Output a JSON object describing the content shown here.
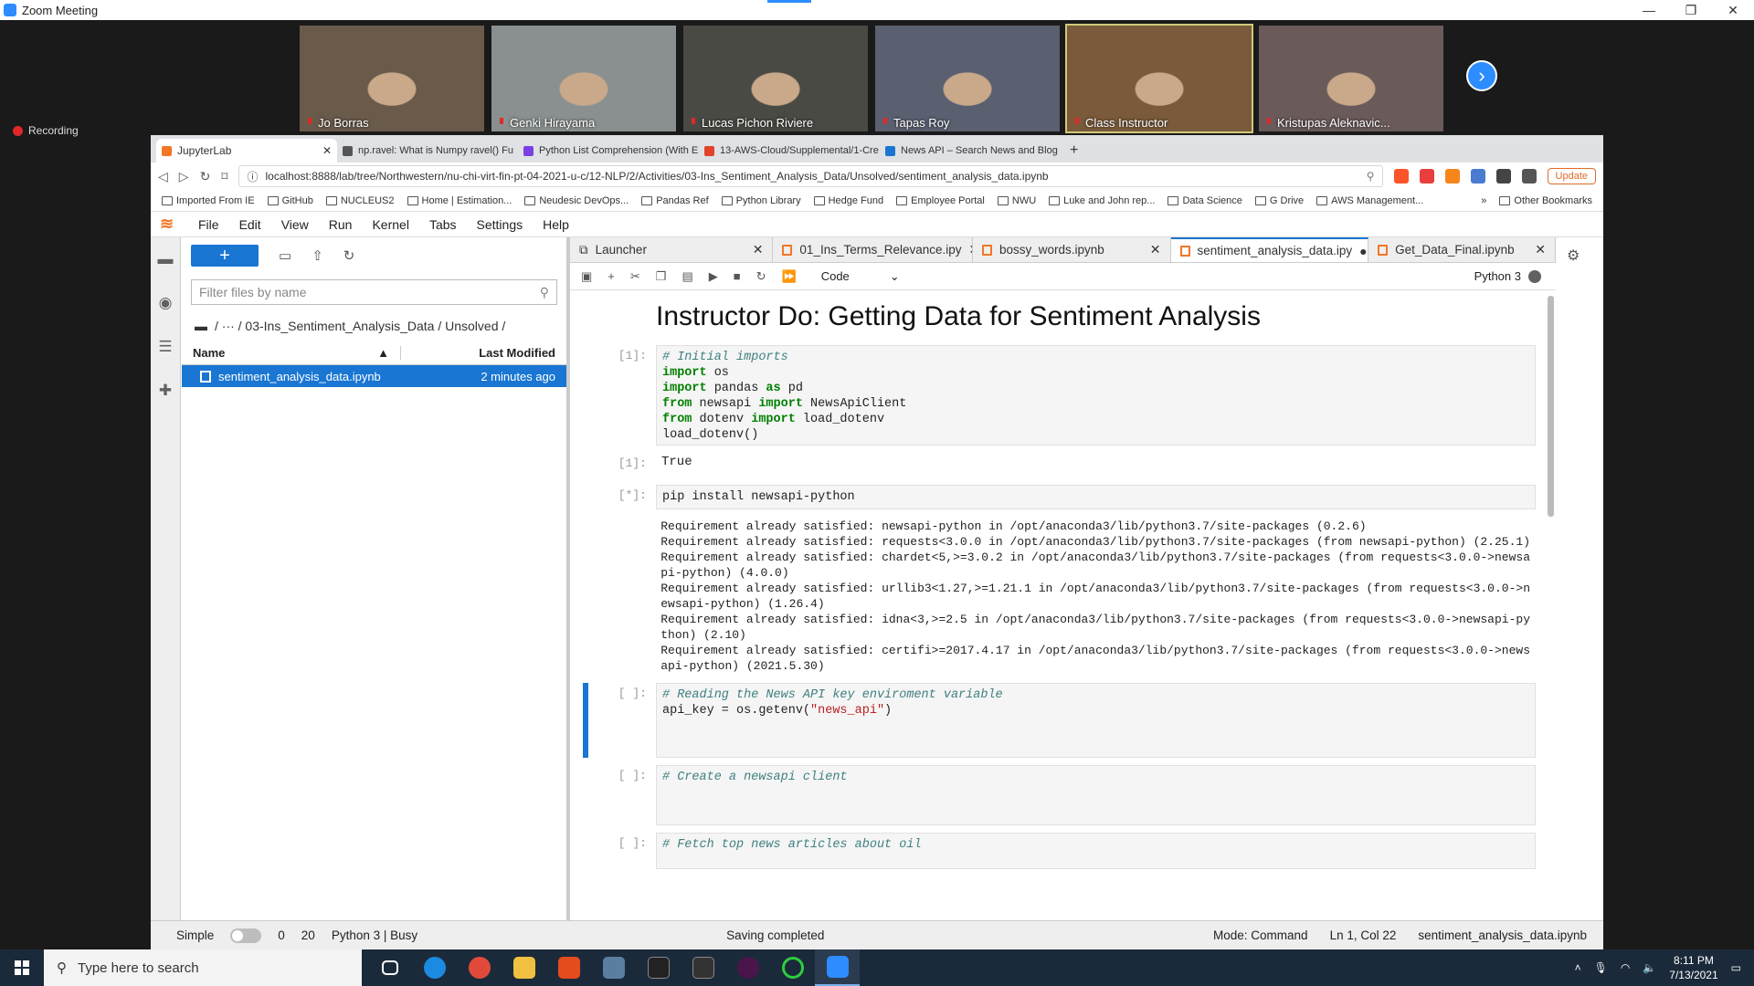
{
  "zoom": {
    "title": "Zoom Meeting",
    "recording": "Recording"
  },
  "participants": [
    {
      "name": "Jo Borras",
      "bg": "#6a5a4a"
    },
    {
      "name": "Genki Hirayama",
      "bg": "#8a9090"
    },
    {
      "name": "Lucas Pichon Riviere",
      "bg": "#4a4a44"
    },
    {
      "name": "Tapas Roy",
      "bg": "#5a6070"
    },
    {
      "name": "Class Instructor",
      "bg": "#7a5a3a"
    },
    {
      "name": "Kristupas Aleknavic...",
      "bg": "#6a5a5a"
    }
  ],
  "browser": {
    "tabs": [
      {
        "label": "JupyterLab",
        "color": "#f37726"
      },
      {
        "label": "np.ravel: What is Numpy ravel() Fu",
        "color": "#555"
      },
      {
        "label": "Python List Comprehension (With E",
        "color": "#7b3fe4"
      },
      {
        "label": "13-AWS-Cloud/Supplemental/1-Cre",
        "color": "#e24329"
      },
      {
        "label": "News API – Search News and Blog",
        "color": "#1976d2"
      }
    ],
    "url": "localhost:8888/lab/tree/Northwestern/nu-chi-virt-fin-pt-04-2021-u-c/12-NLP/2/Activities/03-Ins_Sentiment_Analysis_Data/Unsolved/sentiment_analysis_data.ipynb",
    "update": "Update",
    "bookmarks": [
      "Imported From IE",
      "GitHub",
      "NUCLEUS2",
      "Home | Estimation...",
      "Neudesic DevOps...",
      "Pandas Ref",
      "Python Library",
      "Hedge Fund",
      "Employee Portal",
      "NWU",
      "Luke and John rep...",
      "Data Science",
      "G Drive",
      "AWS Management..."
    ],
    "more": "»",
    "other_bookmarks": "Other Bookmarks"
  },
  "jupyter": {
    "menu": [
      "File",
      "Edit",
      "View",
      "Run",
      "Kernel",
      "Tabs",
      "Settings",
      "Help"
    ],
    "filter_placeholder": "Filter files by name",
    "crumbs": "/   ···  / 03-Ins_Sentiment_Analysis_Data / Unsolved /",
    "col_name": "Name",
    "col_modified": "Last Modified",
    "file": {
      "name": "sentiment_analysis_data.ipynb",
      "modified": "2 minutes ago"
    },
    "doc_tabs": [
      {
        "label": "Launcher",
        "width": 228
      },
      {
        "label": "01_Ins_Terms_Relevance.ipy",
        "width": 224
      },
      {
        "label": "bossy_words.ipynb",
        "width": 222
      },
      {
        "label": "sentiment_analysis_data.ipy",
        "width": 222
      },
      {
        "label": "Get_Data_Final.ipynb",
        "width": 210
      }
    ],
    "cell_type": "Code",
    "kernel": "Python 3",
    "heading": "Instructor Do: Getting Data for Sentiment Analysis",
    "prompt1": "[1]:",
    "out1": "True",
    "prompt2": "[*]:",
    "pip": "pip install newsapi-python",
    "pip_out": "Requirement already satisfied: newsapi-python in /opt/anaconda3/lib/python3.7/site-packages (0.2.6)\nRequirement already satisfied: requests<3.0.0 in /opt/anaconda3/lib/python3.7/site-packages (from newsapi-python) (2.25.1)\nRequirement already satisfied: chardet<5,>=3.0.2 in /opt/anaconda3/lib/python3.7/site-packages (from requests<3.0.0->newsa\npi-python) (4.0.0)\nRequirement already satisfied: urllib3<1.27,>=1.21.1 in /opt/anaconda3/lib/python3.7/site-packages (from requests<3.0.0->n\newsapi-python) (1.26.4)\nRequirement already satisfied: idna<3,>=2.5 in /opt/anaconda3/lib/python3.7/site-packages (from requests<3.0.0->newsapi-py\nthon) (2.10)\nRequirement already satisfied: certifi>=2017.4.17 in /opt/anaconda3/lib/python3.7/site-packages (from requests<3.0.0->news\napi-python) (2021.5.30)",
    "prompt_empty": "[ ]:",
    "comment_reading": "# Reading the News API key enviroment variable",
    "comment_create": "# Create a newsapi client",
    "comment_fetch": "# Fetch top news articles about oil",
    "comment_imports": "# Initial imports"
  },
  "status": {
    "mode_label": "Simple",
    "n1": "0",
    "n2": "20",
    "kernel": "Python 3 | Busy",
    "saving": "Saving completed",
    "mode": "Mode: Command",
    "pos": "Ln 1, Col 22",
    "file": "sentiment_analysis_data.ipynb"
  },
  "taskbar": {
    "search": "Type here to search",
    "time": "8:11 PM",
    "date": "7/13/2021"
  }
}
